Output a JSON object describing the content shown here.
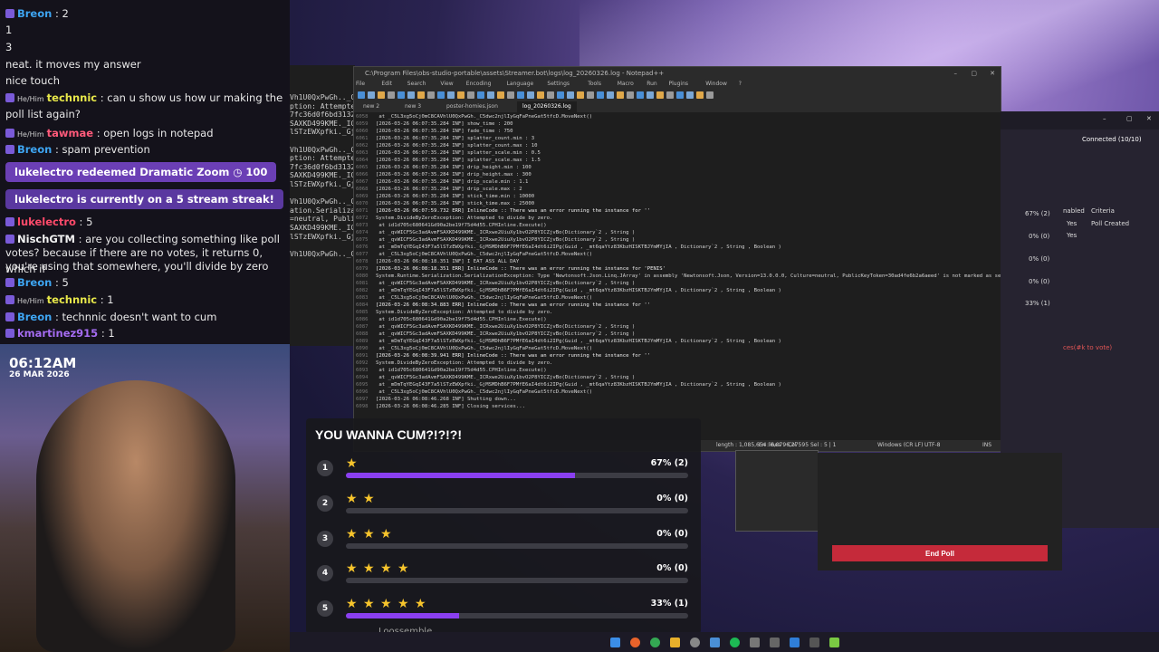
{
  "chat": {
    "lines": [
      {
        "user": "Breon",
        "text": " : 2",
        "color": "#3ea5f2"
      },
      {
        "user": "",
        "text": "1",
        "color": ""
      },
      {
        "user": "",
        "text": "3",
        "color": ""
      },
      {
        "user": "",
        "text": "neat. it moves my answer",
        "color": ""
      },
      {
        "user": "",
        "text": "nice touch",
        "color": ""
      },
      {
        "user": "technnic",
        "pronoun": "He/Him",
        "text": " : can u show us how ur making the",
        "color": "#e7e74a"
      },
      {
        "user": "",
        "text": "poll list again?",
        "color": ""
      },
      {
        "user": "tawmae",
        "pronoun": "He/Him",
        "text": " : open logs in notepad",
        "color": "#ff5a7a"
      },
      {
        "user": "Breon",
        "text": " : spam prevention",
        "color": "#3ea5f2"
      }
    ],
    "redeem": "lukelectro redeemed Dramatic Zoom ◷ 100",
    "streak": "lukelectro is currently on a 5 stream streak!",
    "lines2": [
      {
        "user": "lukelectro",
        "text": " : 5",
        "color": "#ff4a6a"
      },
      {
        "user": "NischGTM",
        "text": " : are you collecting something like poll",
        "color": "#f2f2f2"
      },
      {
        "user": "",
        "text": "votes? because if there are no votes, it returns 0, which if",
        "color": ""
      },
      {
        "user": "",
        "text": "you're using that somewhere, you'll divide by zero",
        "color": ""
      },
      {
        "user": "Breon",
        "text": " : 5",
        "color": "#3ea5f2"
      },
      {
        "user": "technnic",
        "pronoun": "He/Him",
        "text": " : 1",
        "color": "#e7e74a"
      },
      {
        "user": "Breon",
        "text": " : technnic doesn't want to cum",
        "color": "#3ea5f2"
      },
      {
        "user": "kmartinez915",
        "text": " : 1",
        "color": "#a56cf2"
      }
    ]
  },
  "clock": {
    "time": "06:12AM",
    "date": "26 MAR 2026"
  },
  "terminal": {
    "lines": [
      "Vh1U0QxPwGh.._C5",
      "ption: Attempte",
      "7fc36d0f6bd3132",
      "SAXKD499KME._IC",
      "lSTzEWXpfki._Gj",
      "",
      "Vh1U0QxPwGh.._C5",
      "ption: Attempte",
      "7fc36d0f6bd3132",
      "SAXKD499KME._IC",
      "lSTzEWXpfki._Gj",
      "",
      "Vh1U0QxPwGh.._C5",
      "ation.Serializa",
      "=neutral, Publi",
      "SAXKD499KME._IC",
      "lSTzEWXpfki._Gj",
      "",
      "Vh1U0QxPwGh.._C5"
    ]
  },
  "notepad": {
    "title": "C:\\Program Files\\obs-studio-portable\\assets\\Streamer.bot\\logs\\log_20260326.log - Notepad++",
    "menu": [
      "File",
      "Edit",
      "Search",
      "View",
      "Encoding",
      "Language",
      "Settings",
      "Tools",
      "Macro",
      "Run",
      "Plugins",
      "Window",
      "?"
    ],
    "tabs": [
      "new 2",
      "new 3",
      "poster-homies.json",
      "log_20260326.log"
    ],
    "lines": [
      {
        "n": "6058",
        "t": "    at _C5L3xg5oCj0mC8CAVhlU0QxPwGh._C5dwc2njlIyGqFaPneGat5tfcD.MoveNext()"
      },
      {
        "n": "6059",
        "t": "[2026-03-26 06:07:35.284 INF] show_time : 200"
      },
      {
        "n": "6060",
        "t": "[2026-03-26 06:07:35.284 INF] fade_time : 750"
      },
      {
        "n": "6061",
        "t": "[2026-03-26 06:07:35.284 INF] splatter_count.min : 3"
      },
      {
        "n": "6062",
        "t": "[2026-03-26 06:07:35.284 INF] splatter_count.max : 10"
      },
      {
        "n": "6063",
        "t": "[2026-03-26 06:07:35.284 INF] splatter_scale.min : 0.5"
      },
      {
        "n": "6064",
        "t": "[2026-03-26 06:07:35.284 INF] splatter_scale.max : 1.5"
      },
      {
        "n": "6065",
        "t": "[2026-03-26 06:07:35.284 INF] drip_height.min : 100"
      },
      {
        "n": "6066",
        "t": "[2026-03-26 06:07:35.284 INF] drip_height.max : 300"
      },
      {
        "n": "6067",
        "t": "[2026-03-26 06:07:35.284 INF] drip_scale.min : 1.1"
      },
      {
        "n": "6068",
        "t": "[2026-03-26 06:07:35.284 INF] drip_scale.max : 2"
      },
      {
        "n": "6069",
        "t": "[2026-03-26 06:07:35.284 INF] stick_time.min : 10000"
      },
      {
        "n": "6070",
        "t": "[2026-03-26 06:07:35.284 INF] stick_time.max : 25000"
      },
      {
        "n": "6071",
        "t": "[2026-03-26 06:07:59.732 ERR] InlineCode :: There was an error running the instance for ''"
      },
      {
        "n": "6072",
        "t": "System.DivideByZeroException: Attempted to divide by zero."
      },
      {
        "n": "6073",
        "t": "    at id1d705c680641Gd90a2be19f75d4d55.CPHInline.Execute()"
      },
      {
        "n": "6074",
        "t": "    at _qvWICF5Gc3adAvmFSAXKD499KME._ICRxwe2UiuXy1bvO2P8YICZjvBo(Dictionary`2 , String )"
      },
      {
        "n": "6075",
        "t": "    at _qvWICF5Gc3adAvmFSAXKD499KME._ICRxwe2UiuXy1bvO2P8YICZjvBo(Dictionary`2 , String )"
      },
      {
        "n": "6076",
        "t": "    at _mDmTqYEGqI43F7a5lSTzEWXpfki._GjMSMDhB6F7PMfE6aI4dt6i2IPg(Guid , _mt6qaYtz83KbzHISKTBJYmMYjIA , Dictionary`2 , String , Boolean )"
      },
      {
        "n": "6077",
        "t": "    at _C5L3xg5oCj0mC8CAVhlU0QxPwGh._C5dwc2njlIyGqFaPneGat5tfcD.MoveNext()"
      },
      {
        "n": "6078",
        "t": "[2026-03-26 06:08:18.351 INF] I EAT ASS ALL DAY"
      },
      {
        "n": "6079",
        "t": "[2026-03-26 06:08:18.351 ERR] InlineCode :: There was an error running the instance for 'PENIS'"
      },
      {
        "n": "6080",
        "t": "System.Runtime.Serialization.SerializationException: Type 'Newtonsoft.Json.Linq.JArray' in assembly 'Newtonsoft.Json, Version=13.0.0.0, Culture=neutral, PublicKeyToken=30ad4fe6b2a6aeed' is not marked as se"
      },
      {
        "n": "6081",
        "t": "    at _qvWICF5Gc3adAvmFSAXKD499KME._ICRxwe2UiuXy1bvO2P8YICZjvBo(Dictionary`2 , String )"
      },
      {
        "n": "6082",
        "t": "    at _mDmTqYEGqI43F7a5lSTzEWXpfki._GjMSMDhB6F7PMfE6aI4dt6i2IPg(Guid , _mt6qaYtz83KbzHISKTBJYmMYjIA , Dictionary`2 , String , Boolean )"
      },
      {
        "n": "6083",
        "t": "    at _C5L3xg5oCj0mC8CAVhlU0QxPwGh._C5dwc2njlIyGqFaPneGat5tfcD.MoveNext()"
      },
      {
        "n": "6084",
        "t": "[2026-03-26 06:08:34.883 ERR] InlineCode :: There was an error running the instance for ''"
      },
      {
        "n": "6085",
        "t": "System.DivideByZeroException: Attempted to divide by zero."
      },
      {
        "n": "6086",
        "t": "    at id1d705c680641Gd90a2be19f75d4d55.CPHInline.Execute()"
      },
      {
        "n": "6087",
        "t": "    at _qvWICF5Gc3adAvmFSAXKD499KME._ICRxwe2UiuXy1bvO2P8YICZjvBo(Dictionary`2 , String )"
      },
      {
        "n": "6088",
        "t": "    at _qvWICF5Gc3adAvmFSAXKD499KME._ICRxwe2UiuXy1bvO2P8YICZjvBo(Dictionary`2 , String )"
      },
      {
        "n": "6089",
        "t": "    at _mDmTqYEGqI43F7a5lSTzEWXpfki._GjMSMDhB6F7PMfE6aI4dt6i2IPg(Guid , _mt6qaYtz83KbzHISKTBJYmMYjIA , Dictionary`2 , String , Boolean )"
      },
      {
        "n": "6090",
        "t": "    at _C5L3xg5oCj0mC8CAVhlU0QxPwGh._C5dwc2njlIyGqFaPneGat5tfcD.MoveNext()"
      },
      {
        "n": "6091",
        "t": "[2026-03-26 06:08:39.941 ERR] InlineCode :: There was an error running the instance for ''"
      },
      {
        "n": "6092",
        "t": "System.DivideByZeroException: Attempted to divide by zero."
      },
      {
        "n": "6093",
        "t": "    at id1d705c680641Gd90a2be19f75d4d55.CPHInline.Execute()"
      },
      {
        "n": "6094",
        "t": "    at _qvWICF5Gc3adAvmFSAXKD499KME._ICRxwe2UiuXy1bvO2P8YICZjvBo(Dictionary`2 , String )"
      },
      {
        "n": "6095",
        "t": "    at _mDmTqYEGqI43F7a5lSTzEWXpfki._GjMSMDhB6F7PMfE6aI4dt6i2IPg(Guid , _mt6qaYtz83KbzHISKTBJYmMYjIA , Dictionary`2 , String , Boolean )"
      },
      {
        "n": "6096",
        "t": "    at _C5L3xg5oCj0mC8CAVhlU0QxPwGh._C5dwc2njlIyGqFaPneGat5tfcD.MoveNext()"
      },
      {
        "n": "6097",
        "t": "[2026-03-26 06:08:46.268 INF] Shutting down..."
      },
      {
        "n": "6098",
        "t": "[2026-03-26 06:08:46.285 INF] Closing services..."
      }
    ],
    "status": {
      "length": "length : 1,085,654   lines : 6,275",
      "pos": "Ln : 6,079   Col : 95   Sel : 5 | 1",
      "eol": "Windows (CR LF)",
      "enc": "UTF-8",
      "mode": "INS"
    }
  },
  "right_panel": {
    "connected": "Connected (10/10)",
    "col_enabled": "nabled",
    "col_criteria": "Criteria",
    "row1_enabled": "Yes",
    "row1_criteria": "Poll Created",
    "row2_enabled": "Yes",
    "pcts": [
      "67% (2)",
      "0% (0)",
      "0% (0)",
      "0% (0)",
      "33% (1)"
    ],
    "vote_hint": "ces(#k to vote)",
    "end_poll": "End Poll"
  },
  "poll": {
    "title": "YOU WANNA CUM?!?!?!",
    "options": [
      {
        "num": "1",
        "stars": "★",
        "pct": "67% (2)",
        "fill": 0.67
      },
      {
        "num": "2",
        "stars": "★ ★",
        "pct": "0% (0)",
        "fill": 0
      },
      {
        "num": "3",
        "stars": "★ ★ ★",
        "pct": "0% (0)",
        "fill": 0
      },
      {
        "num": "4",
        "stars": "★ ★ ★ ★",
        "pct": "0% (0)",
        "fill": 0
      },
      {
        "num": "5",
        "stars": "★ ★ ★ ★ ★",
        "pct": "33% (1)",
        "fill": 0.33
      }
    ],
    "footer": "Loossemble"
  },
  "colors": {
    "accent": "#8a3ff0",
    "end_poll": "#c52a3a",
    "star": "#f6c42c"
  }
}
